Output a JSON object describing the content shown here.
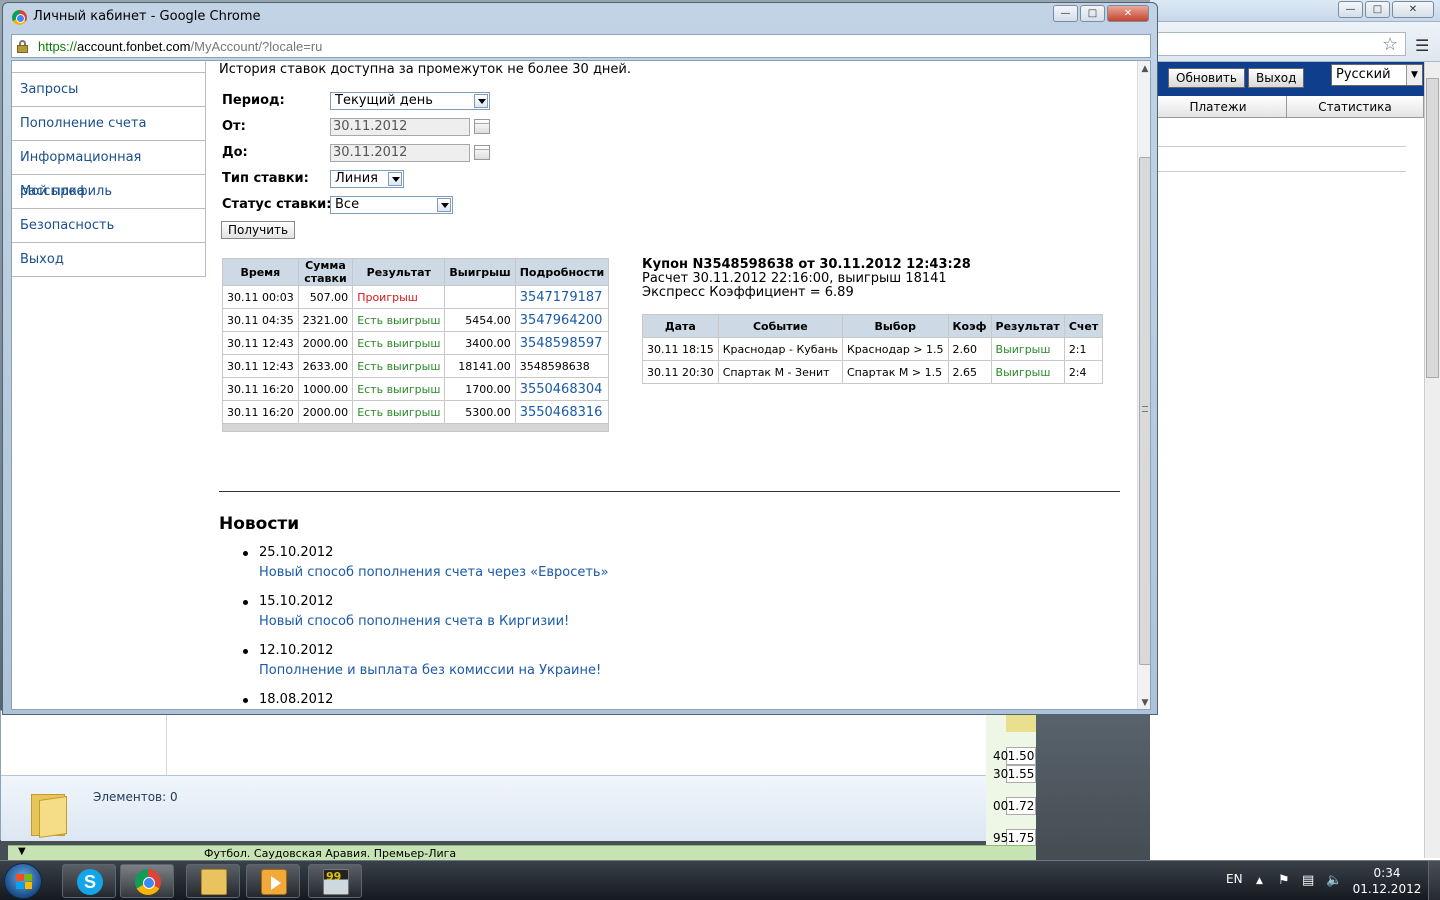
{
  "background_window": {
    "buttons": {
      "refresh": "Обновить",
      "logout": "Выход"
    },
    "language": "Русский",
    "tabs": [
      "Платежи",
      "Статистика"
    ]
  },
  "explorer": {
    "status": "Элементов: 0"
  },
  "odds_fragment": [
    {
      "prefix": "40",
      "value": "1.50"
    },
    {
      "prefix": "30",
      "value": "1.55"
    },
    {
      "prefix": "00",
      "value": "1.72"
    },
    {
      "prefix": "95",
      "value": "1.75"
    }
  ],
  "footer_band": "Футбол. Саудовская Аравия. Премьер-Лига",
  "window": {
    "title": "Личный кабинет - Google Chrome",
    "url": {
      "scheme": "https://",
      "host": "account.fonbet.com",
      "path": "/MyAccount/?locale=ru"
    }
  },
  "sidebar": {
    "items": [
      "Запросы",
      "Пополнение счета",
      "Информационная рассылка",
      "Мой профиль",
      "Безопасность",
      "Выход"
    ]
  },
  "history": {
    "note": "История ставок доступна за промежуток не более 30 дней.",
    "period_label": "Период:",
    "period_value": "Текущий день",
    "from_label": "От:",
    "from_value": "30.11.2012",
    "to_label": "До:",
    "to_value": "30.11.2012",
    "bet_type_label": "Тип ставки:",
    "bet_type_value": "Линия",
    "status_label": "Статус ставки:",
    "status_value": "Все",
    "get_button": "Получить"
  },
  "bets_table": {
    "headers": [
      "Время",
      "Сумма ставки",
      "Результат",
      "Выигрыш",
      "Подробности"
    ],
    "rows": [
      {
        "time": "30.11 00:03",
        "amount": "507.00",
        "result": "Проигрыш",
        "status": "lose",
        "win": "",
        "details": "3547179187",
        "link": true
      },
      {
        "time": "30.11 04:35",
        "amount": "2321.00",
        "result": "Есть выигрыш",
        "status": "win",
        "win": "5454.00",
        "details": "3547964200",
        "link": true
      },
      {
        "time": "30.11 12:43",
        "amount": "2000.00",
        "result": "Есть выигрыш",
        "status": "win",
        "win": "3400.00",
        "details": "3548598597",
        "link": true
      },
      {
        "time": "30.11 12:43",
        "amount": "2633.00",
        "result": "Есть выигрыш",
        "status": "win",
        "win": "18141.00",
        "details": "3548598638",
        "link": false
      },
      {
        "time": "30.11 16:20",
        "amount": "1000.00",
        "result": "Есть выигрыш",
        "status": "win",
        "win": "1700.00",
        "details": "3550468304",
        "link": true
      },
      {
        "time": "30.11 16:20",
        "amount": "2000.00",
        "result": "Есть выигрыш",
        "status": "win",
        "win": "5300.00",
        "details": "3550468316",
        "link": true
      }
    ]
  },
  "coupon": {
    "heading": "Купон N3548598638 от 30.11.2012 12:43:28",
    "calc": "Расчет 30.11.2012 22:16:00, выигрыш 18141",
    "coef": "Экспресс Коэффициент = 6.89",
    "headers": [
      "Дата",
      "Событие",
      "Выбор",
      "Коэф",
      "Результат",
      "Счет"
    ],
    "rows": [
      {
        "date": "30.11 18:15",
        "event": "Краснодар - Кубань",
        "choice": "Краснодар > 1.5",
        "coef": "2.60",
        "result": "Выигрыш",
        "score": "2:1"
      },
      {
        "date": "30.11 20:30",
        "event": "Спартак М - Зенит",
        "choice": "Спартак М > 1.5",
        "coef": "2.65",
        "result": "Выигрыш",
        "score": "2:4"
      }
    ]
  },
  "news": {
    "heading": "Новости",
    "items": [
      {
        "date": "25.10.2012",
        "title": "Новый способ пополнения счета через «Евросеть»"
      },
      {
        "date": "15.10.2012",
        "title": "Новый способ пополнения счета в Киргизии!"
      },
      {
        "date": "12.10.2012",
        "title": "Пополнение и выплата без комиссии на Украине!"
      },
      {
        "date": "18.08.2012",
        "title": ""
      }
    ]
  },
  "taskbar": {
    "lang": "EN",
    "time": "0:34",
    "date": "01.12.2012",
    "app_badge": "99"
  }
}
